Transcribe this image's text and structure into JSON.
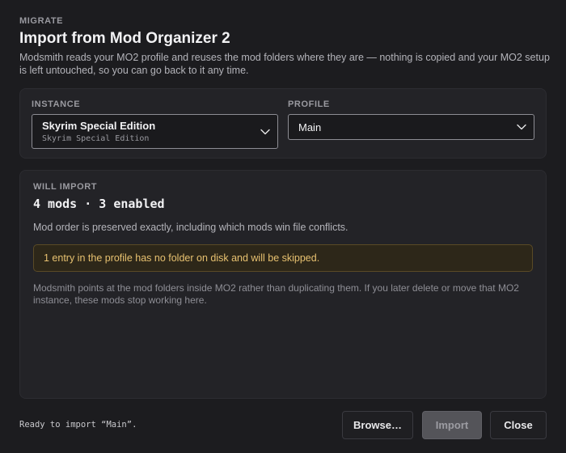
{
  "header": {
    "eyebrow": "MIGRATE",
    "title": "Import from Mod Organizer 2",
    "description": "Modsmith reads your MO2 profile and reuses the mod folders where they are — nothing is copied and your MO2 setup is left untouched, so you can go back to it any time."
  },
  "source": {
    "instance_label": "INSTANCE",
    "instance_name": "Skyrim Special Edition",
    "instance_sub": "Skyrim Special Edition",
    "profile_label": "PROFILE",
    "profile_value": "Main"
  },
  "import": {
    "label": "WILL IMPORT",
    "summary": "4 mods · 3 enabled",
    "order_note": "Mod order is preserved exactly, including which mods win file conflicts.",
    "warning": "1 entry in the profile has no folder on disk and will be skipped.",
    "footnote": "Modsmith points at the mod folders inside MO2 rather than duplicating them. If you later delete or move that MO2 instance, these mods stop working here."
  },
  "footer": {
    "status": "Ready to import “Main”.",
    "browse_label": "Browse…",
    "import_label": "Import",
    "close_label": "Close"
  },
  "icons": {
    "dropdown": "chevron-down-icon"
  },
  "colors": {
    "warning_text": "#e7c170",
    "warning_bg": "#2d2719"
  }
}
